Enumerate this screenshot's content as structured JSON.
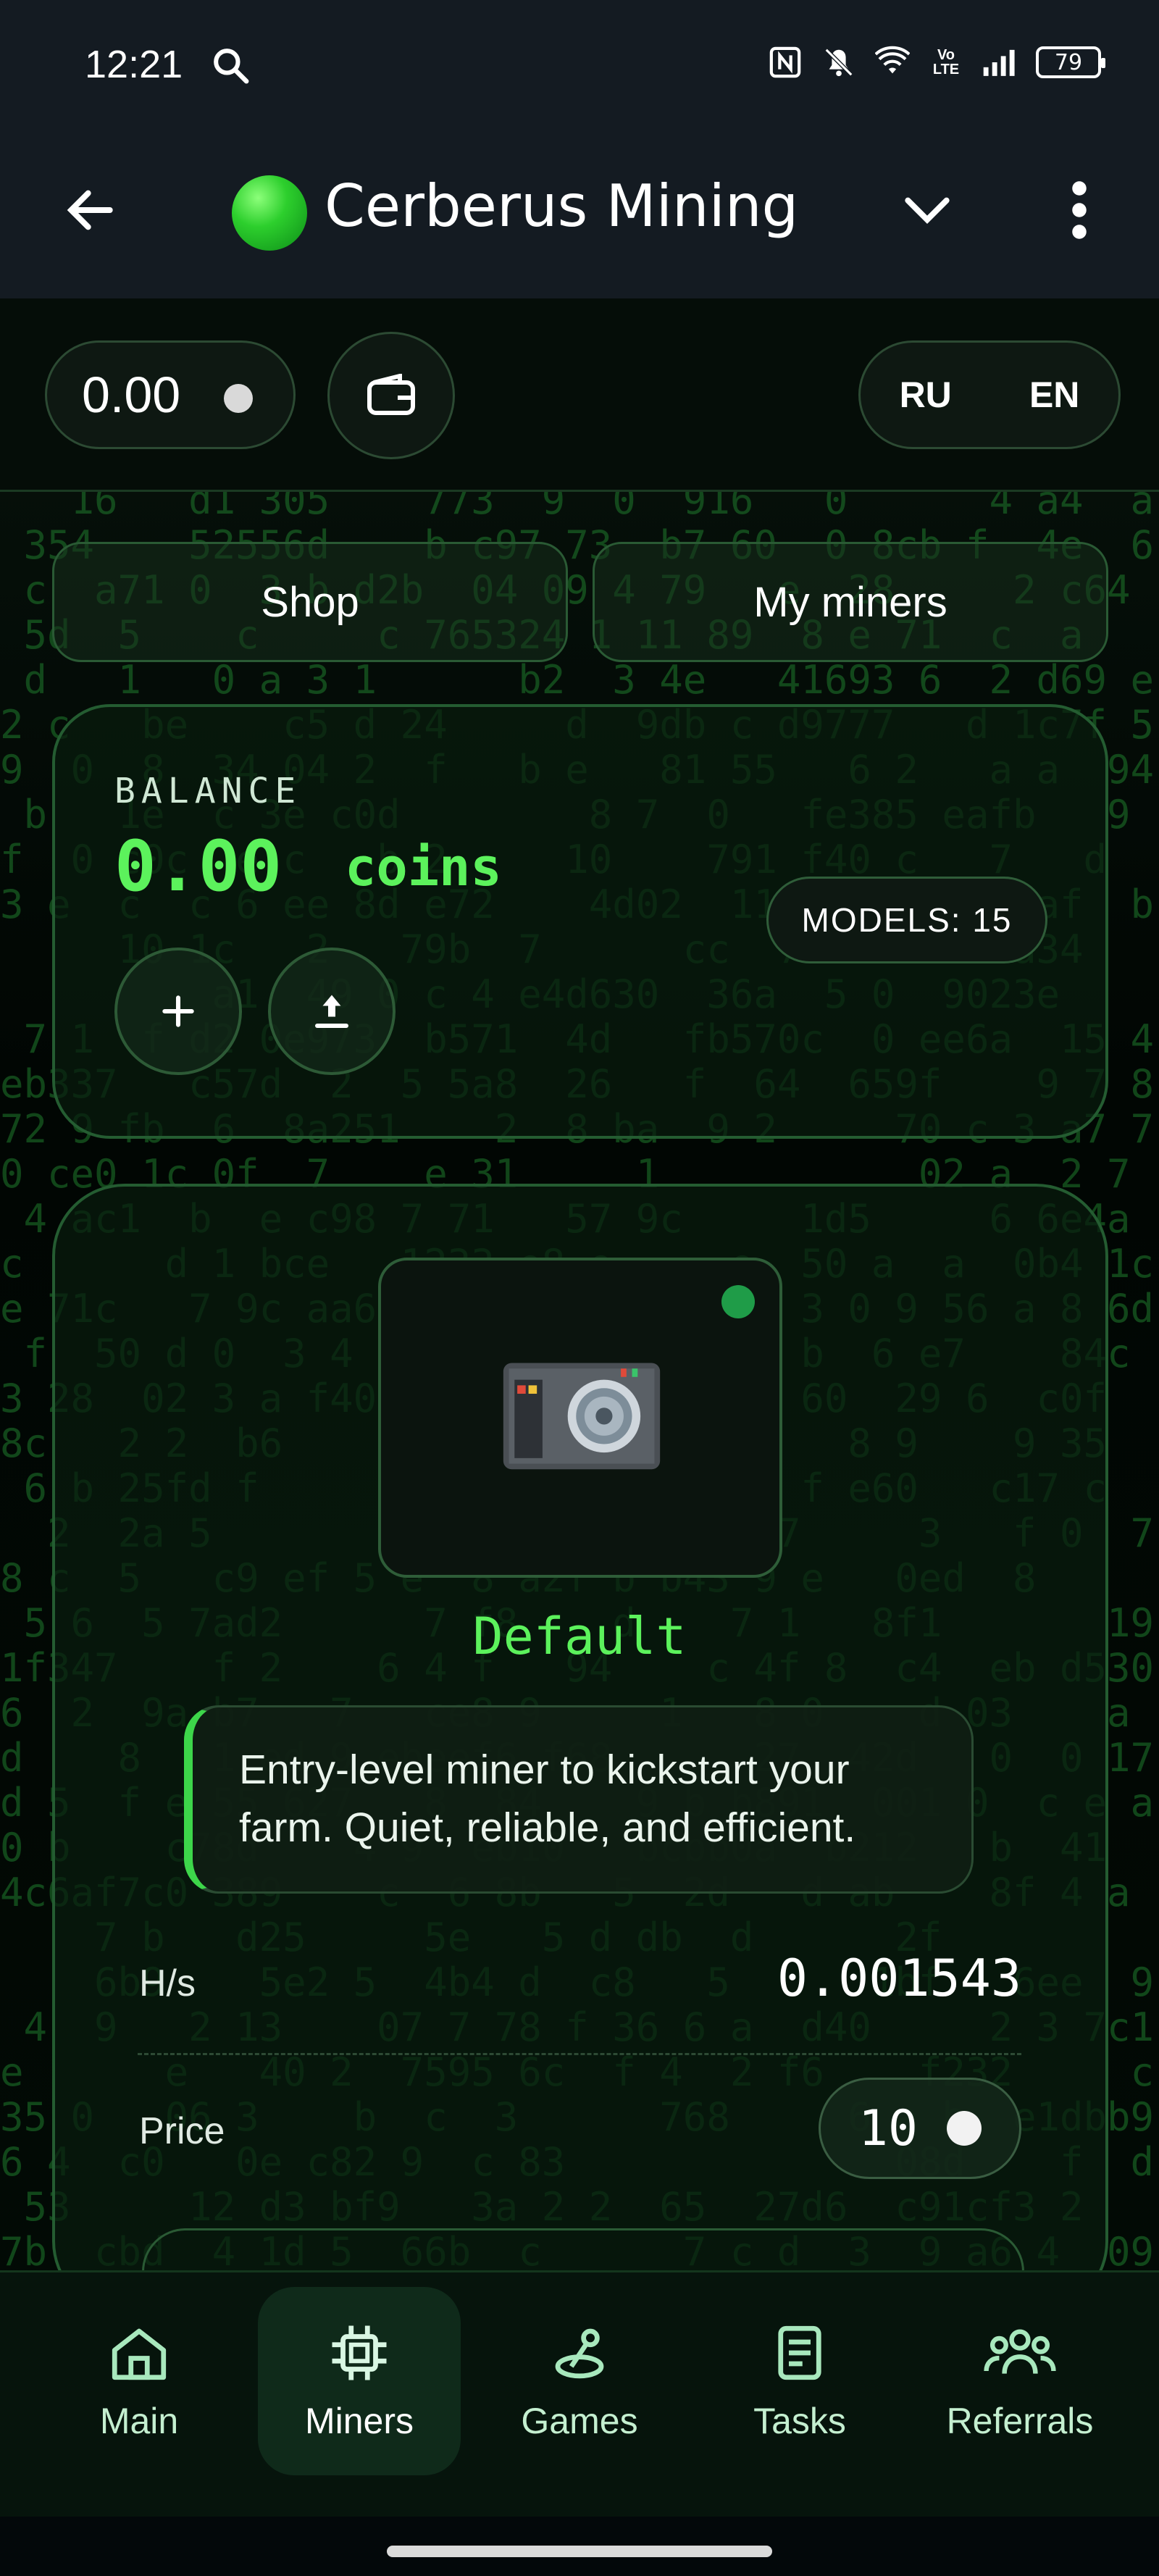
{
  "status_bar": {
    "time": "12:21",
    "battery": "79",
    "icons": [
      "search-icon",
      "nfc-icon",
      "mute-icon",
      "wifi-icon",
      "volte-icon",
      "signal-icon",
      "battery-icon"
    ]
  },
  "app_bar": {
    "title": "Cerberus Mining",
    "icons": [
      "back-arrow-icon",
      "green-dot-icon",
      "chevron-down-icon",
      "more-vert-icon"
    ]
  },
  "header": {
    "balance": "0.00",
    "languages": [
      "RU",
      "EN"
    ]
  },
  "tabs": {
    "shop": "Shop",
    "my_miners": "My miners"
  },
  "balance_card": {
    "label": "BALANCE",
    "amount": "0.00",
    "unit": "coins",
    "models": "MODELS: 15"
  },
  "miner": {
    "name": "Default",
    "description_line1": "Entry-level miner to kickstart your",
    "description_line2": "farm. Quiet, reliable, and efficient.",
    "hashrate_label": "H/s",
    "hashrate_value": "0.001543",
    "price_label": "Price",
    "price_value": "10"
  },
  "bottom_nav": {
    "items": [
      {
        "label": "Main",
        "icon": "home-icon"
      },
      {
        "label": "Miners",
        "icon": "chip-icon"
      },
      {
        "label": "Games",
        "icon": "joystick-icon"
      },
      {
        "label": "Tasks",
        "icon": "clipboard-icon"
      },
      {
        "label": "Referrals",
        "icon": "people-icon"
      }
    ]
  },
  "colors": {
    "accent": "#5cf25c",
    "background": "#020a05",
    "bar": "#141b22"
  }
}
